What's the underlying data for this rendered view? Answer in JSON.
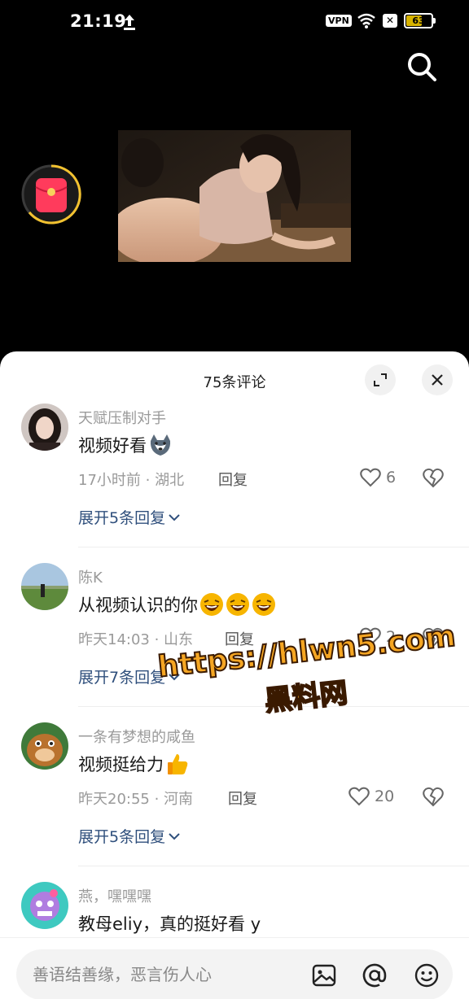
{
  "status_bar": {
    "time": "21:19",
    "vpn": "VPN",
    "x_badge": "✕",
    "battery": "63",
    "battery_level": 0.63
  },
  "sheet": {
    "title": "75条评论"
  },
  "comments": [
    {
      "name": "天赋压制对手",
      "text": "视频好看",
      "emoji": "husky-emoji",
      "meta": "17小时前 · 湖北",
      "reply_label": "回复",
      "likes": "6",
      "expand": "展开5条回复"
    },
    {
      "name": "陈K",
      "text": "从视频认识的你",
      "emoji": "laughing-emoji",
      "meta": "昨天14:03 · 山东",
      "reply_label": "回复",
      "likes": "2",
      "expand": "展开7条回复"
    },
    {
      "name": "一条有梦想的咸鱼",
      "text": "视频挺给力",
      "emoji": "thumbs-up-emoji",
      "meta": "昨天20:55 · 河南",
      "reply_label": "回复",
      "likes": "20",
      "expand": "展开5条回复"
    },
    {
      "name": "燕，嘿嘿嘿",
      "text": "教母eliy，真的挺好看 y"
    }
  ],
  "watermark": {
    "url": "https://hlwn5.com",
    "name": "黑料网"
  },
  "input_bar": {
    "placeholder": "善语结善缘，恶言伤人心"
  },
  "colors": {
    "link": "#2f4f7c",
    "watermark": "#f5a623",
    "redpacket": "#ff3b5c"
  }
}
